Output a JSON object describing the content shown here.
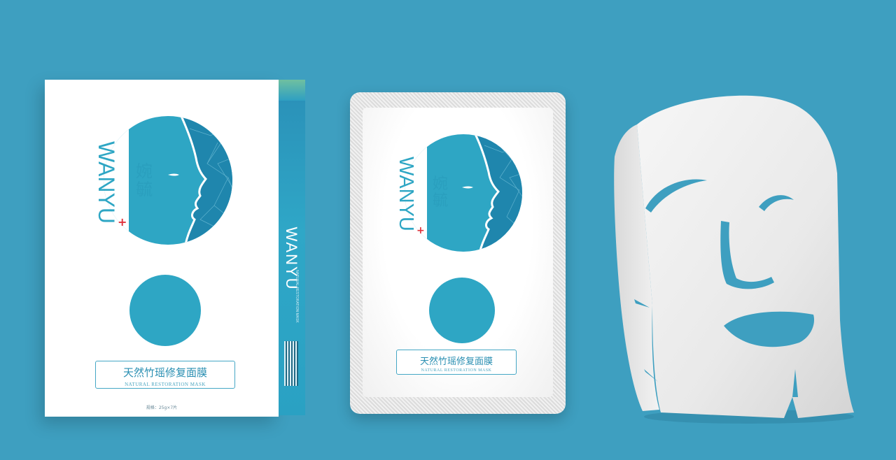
{
  "scene": {
    "background_color": "#3e9fc0",
    "accent_color": "#2ea6c4",
    "cross_color": "#e0303a"
  },
  "box": {
    "brand_en": "WANYU",
    "brand_cn": "婉毓",
    "product_cn": "天然竹瑶修复面膜",
    "product_en": "NATURAL RESTORATION MASK",
    "spec": "规格：25g×7片",
    "side_brand": "WANYU",
    "side_small": "NATURAL RESTORATION MASK"
  },
  "sachet": {
    "brand_en": "WANYU",
    "brand_cn": "婉毓",
    "product_cn": "天然竹瑶修复面膜",
    "product_en": "NATURAL RESTORATION MASK"
  },
  "icons": {
    "face_profile": "face-profile-icon",
    "plus": "plus-icon",
    "qr": "qr-code-icon"
  }
}
